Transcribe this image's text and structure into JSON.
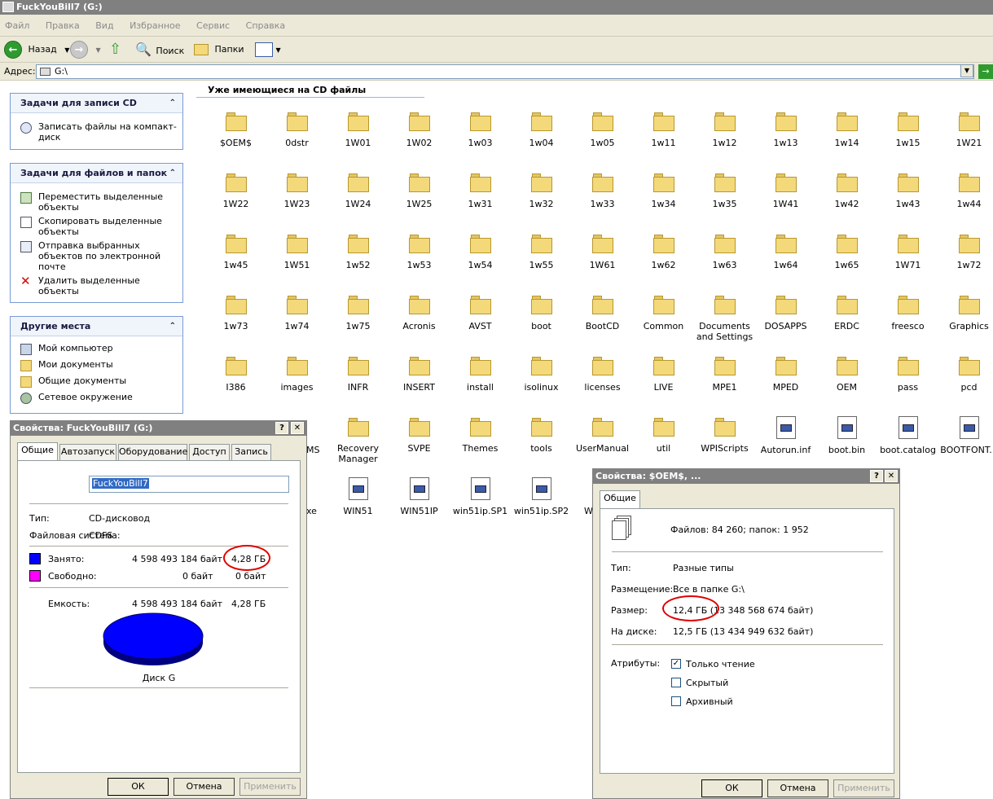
{
  "window": {
    "title": "FuckYouBill7 (G:)"
  },
  "menu": [
    "Файл",
    "Правка",
    "Вид",
    "Избранное",
    "Сервис",
    "Справка"
  ],
  "toolbar": {
    "back": "Назад",
    "search": "Поиск",
    "folders": "Папки"
  },
  "address": {
    "label": "Адрес:",
    "value": "G:\\"
  },
  "sidebar": {
    "panel1": {
      "title": "Задачи для записи CD",
      "items": [
        "Записать файлы на компакт-диск"
      ]
    },
    "panel2": {
      "title": "Задачи для файлов и папок",
      "items": [
        "Переместить выделенные объекты",
        "Скопировать выделенные объекты",
        "Отправка выбранных объектов по электронной почте",
        "Удалить выделенные объекты"
      ]
    },
    "panel3": {
      "title": "Другие места",
      "items": [
        "Мой компьютер",
        "Мои документы",
        "Общие документы",
        "Сетевое окружение"
      ]
    }
  },
  "content": {
    "title": "Уже имеющиеся на CD файлы",
    "items": [
      {
        "name": "$OEM$",
        "type": "folder"
      },
      {
        "name": "0dstr",
        "type": "folder"
      },
      {
        "name": "1W01",
        "type": "folder"
      },
      {
        "name": "1W02",
        "type": "folder"
      },
      {
        "name": "1w03",
        "type": "folder"
      },
      {
        "name": "1w04",
        "type": "folder"
      },
      {
        "name": "1w05",
        "type": "folder"
      },
      {
        "name": "1w11",
        "type": "folder"
      },
      {
        "name": "1w12",
        "type": "folder"
      },
      {
        "name": "1w13",
        "type": "folder"
      },
      {
        "name": "1w14",
        "type": "folder"
      },
      {
        "name": "1w15",
        "type": "folder"
      },
      {
        "name": "1W21",
        "type": "folder"
      },
      {
        "name": "1W22",
        "type": "folder"
      },
      {
        "name": "1W23",
        "type": "folder"
      },
      {
        "name": "1W24",
        "type": "folder"
      },
      {
        "name": "1W25",
        "type": "folder"
      },
      {
        "name": "1w31",
        "type": "folder"
      },
      {
        "name": "1w32",
        "type": "folder"
      },
      {
        "name": "1w33",
        "type": "folder"
      },
      {
        "name": "1w34",
        "type": "folder"
      },
      {
        "name": "1w35",
        "type": "folder"
      },
      {
        "name": "1W41",
        "type": "folder"
      },
      {
        "name": "1w42",
        "type": "folder"
      },
      {
        "name": "1w43",
        "type": "folder"
      },
      {
        "name": "1w44",
        "type": "folder"
      },
      {
        "name": "1w45",
        "type": "folder"
      },
      {
        "name": "1W51",
        "type": "folder"
      },
      {
        "name": "1w52",
        "type": "folder"
      },
      {
        "name": "1w53",
        "type": "folder"
      },
      {
        "name": "1w54",
        "type": "folder"
      },
      {
        "name": "1w55",
        "type": "folder"
      },
      {
        "name": "1W61",
        "type": "folder"
      },
      {
        "name": "1w62",
        "type": "folder"
      },
      {
        "name": "1w63",
        "type": "folder"
      },
      {
        "name": "1w64",
        "type": "folder"
      },
      {
        "name": "1w65",
        "type": "folder"
      },
      {
        "name": "1W71",
        "type": "folder"
      },
      {
        "name": "1w72",
        "type": "folder"
      },
      {
        "name": "1w73",
        "type": "folder"
      },
      {
        "name": "1w74",
        "type": "folder"
      },
      {
        "name": "1w75",
        "type": "folder"
      },
      {
        "name": "Acronis",
        "type": "folder"
      },
      {
        "name": "AVST",
        "type": "folder"
      },
      {
        "name": "boot",
        "type": "folder"
      },
      {
        "name": "BootCD",
        "type": "folder"
      },
      {
        "name": "Common",
        "type": "folder"
      },
      {
        "name": "Documents and Settings",
        "type": "folder"
      },
      {
        "name": "DOSAPPS",
        "type": "folder"
      },
      {
        "name": "ERDC",
        "type": "folder"
      },
      {
        "name": "freesco",
        "type": "folder"
      },
      {
        "name": "Graphics",
        "type": "folder"
      },
      {
        "name": "I386",
        "type": "folder"
      },
      {
        "name": "images",
        "type": "folder"
      },
      {
        "name": "INFR",
        "type": "folder"
      },
      {
        "name": "INSERT",
        "type": "folder"
      },
      {
        "name": "install",
        "type": "folder"
      },
      {
        "name": "isolinux",
        "type": "folder"
      },
      {
        "name": "licenses",
        "type": "folder"
      },
      {
        "name": "LIVE",
        "type": "folder"
      },
      {
        "name": "MPE1",
        "type": "folder"
      },
      {
        "name": "MPED",
        "type": "folder"
      },
      {
        "name": "OEM",
        "type": "folder"
      },
      {
        "name": "pass",
        "type": "folder"
      },
      {
        "name": "pcd",
        "type": "folder"
      },
      {
        "name": "Recovery Manager",
        "type": "folder"
      },
      {
        "name": "SVPE",
        "type": "folder"
      },
      {
        "name": "Themes",
        "type": "folder"
      },
      {
        "name": "tools",
        "type": "folder"
      },
      {
        "name": "UserManual",
        "type": "folder"
      },
      {
        "name": "util",
        "type": "folder"
      },
      {
        "name": "WPIScripts",
        "type": "folder"
      },
      {
        "name": "Autorun.inf",
        "type": "file"
      },
      {
        "name": "boot.bin",
        "type": "file"
      },
      {
        "name": "boot.catalog",
        "type": "file"
      },
      {
        "name": "BOOTFONT...",
        "type": "file"
      },
      {
        "name": "WIN51",
        "type": "file"
      },
      {
        "name": "WIN51IP",
        "type": "file"
      },
      {
        "name": "win51ip.SP1",
        "type": "file"
      },
      {
        "name": "win51ip.SP2",
        "type": "file"
      }
    ],
    "partial_labels": [
      "MS",
      "xe",
      "W"
    ]
  },
  "drive_dialog": {
    "title": "Свойства: FuckYouBill7 (G:)",
    "tabs": [
      "Общие",
      "Автозапуск",
      "Оборудование",
      "Доступ",
      "Запись"
    ],
    "name_value": "FuckYouBill7",
    "type_label": "Тип:",
    "type_value": "CD-дисковод",
    "fs_label": "Файловая система:",
    "fs_value": "CDFS",
    "used_label": "Занято:",
    "used_bytes": "4 598 493 184 байт",
    "used_size": "4,28 ГБ",
    "free_label": "Свободно:",
    "free_bytes": "0 байт",
    "free_size": "0 байт",
    "capacity_label": "Емкость:",
    "capacity_bytes": "4 598 493 184 байт",
    "capacity_size": "4,28 ГБ",
    "disk_label": "Диск G",
    "ok": "ОК",
    "cancel": "Отмена",
    "apply": "Применить",
    "used_color": "#0000ff",
    "free_color": "#ff00ff"
  },
  "folder_dialog": {
    "title": "Свойства: $OEM$, ...",
    "tab": "Общие",
    "summary": "Файлов: 84 260; папок: 1 952",
    "type_label": "Тип:",
    "type_value": "Разные типы",
    "location_label": "Размещение:",
    "location_value": "Все в папке G:\\",
    "size_label": "Размер:",
    "size_value": "12,4 ГБ (13 348 568 674 байт)",
    "disk_label": "На диске:",
    "disk_value": "12,5 ГБ (13 434 949 632 байт)",
    "attr_label": "Атрибуты:",
    "attrs": [
      "Только чтение",
      "Скрытый",
      "Архивный"
    ],
    "ok": "ОК",
    "cancel": "Отмена",
    "apply": "Применить"
  },
  "highlight_color": "#e00000"
}
